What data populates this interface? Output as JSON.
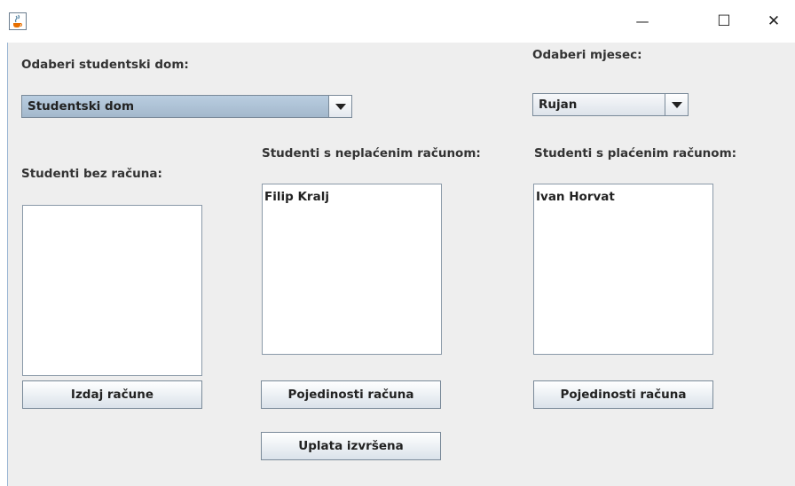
{
  "window": {
    "controls": {
      "minimize": "—",
      "maximize": "☐",
      "close": "✕"
    }
  },
  "dorm": {
    "label": "Odaberi studentski dom:",
    "selected": "Studentski dom"
  },
  "month": {
    "label": "Odaberi mjesec:",
    "selected": "Rujan"
  },
  "lists": {
    "without": {
      "label": "Studenti bez računa:",
      "items": []
    },
    "unpaid": {
      "label": "Studenti s neplaćenim računom:",
      "items": [
        "Filip Kralj"
      ]
    },
    "paid": {
      "label": "Studenti s plaćenim računom:",
      "items": [
        "Ivan Horvat"
      ]
    }
  },
  "buttons": {
    "issue": "Izdaj račune",
    "details_unpaid": "Pojedinosti računa",
    "payment_done": "Uplata izvršena",
    "details_paid": "Pojedinosti računa"
  },
  "icons": {
    "app": "java-coffee-icon",
    "dropdown": "triangle-down-icon"
  },
  "colors": {
    "selection": "#a3b8cc",
    "background": "#eeeeee",
    "border": "#7a8a99"
  }
}
